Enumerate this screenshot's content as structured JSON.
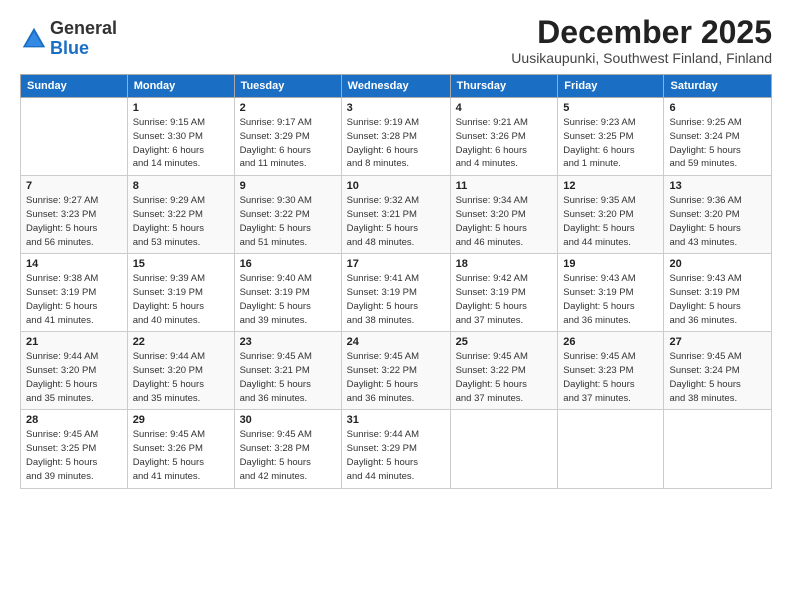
{
  "header": {
    "logo_general": "General",
    "logo_blue": "Blue",
    "main_title": "December 2025",
    "subtitle": "Uusikaupunki, Southwest Finland, Finland"
  },
  "days_of_week": [
    "Sunday",
    "Monday",
    "Tuesday",
    "Wednesday",
    "Thursday",
    "Friday",
    "Saturday"
  ],
  "weeks": [
    [
      {
        "day": "",
        "info": ""
      },
      {
        "day": "1",
        "info": "Sunrise: 9:15 AM\nSunset: 3:30 PM\nDaylight: 6 hours\nand 14 minutes."
      },
      {
        "day": "2",
        "info": "Sunrise: 9:17 AM\nSunset: 3:29 PM\nDaylight: 6 hours\nand 11 minutes."
      },
      {
        "day": "3",
        "info": "Sunrise: 9:19 AM\nSunset: 3:28 PM\nDaylight: 6 hours\nand 8 minutes."
      },
      {
        "day": "4",
        "info": "Sunrise: 9:21 AM\nSunset: 3:26 PM\nDaylight: 6 hours\nand 4 minutes."
      },
      {
        "day": "5",
        "info": "Sunrise: 9:23 AM\nSunset: 3:25 PM\nDaylight: 6 hours\nand 1 minute."
      },
      {
        "day": "6",
        "info": "Sunrise: 9:25 AM\nSunset: 3:24 PM\nDaylight: 5 hours\nand 59 minutes."
      }
    ],
    [
      {
        "day": "7",
        "info": "Sunrise: 9:27 AM\nSunset: 3:23 PM\nDaylight: 5 hours\nand 56 minutes."
      },
      {
        "day": "8",
        "info": "Sunrise: 9:29 AM\nSunset: 3:22 PM\nDaylight: 5 hours\nand 53 minutes."
      },
      {
        "day": "9",
        "info": "Sunrise: 9:30 AM\nSunset: 3:22 PM\nDaylight: 5 hours\nand 51 minutes."
      },
      {
        "day": "10",
        "info": "Sunrise: 9:32 AM\nSunset: 3:21 PM\nDaylight: 5 hours\nand 48 minutes."
      },
      {
        "day": "11",
        "info": "Sunrise: 9:34 AM\nSunset: 3:20 PM\nDaylight: 5 hours\nand 46 minutes."
      },
      {
        "day": "12",
        "info": "Sunrise: 9:35 AM\nSunset: 3:20 PM\nDaylight: 5 hours\nand 44 minutes."
      },
      {
        "day": "13",
        "info": "Sunrise: 9:36 AM\nSunset: 3:20 PM\nDaylight: 5 hours\nand 43 minutes."
      }
    ],
    [
      {
        "day": "14",
        "info": "Sunrise: 9:38 AM\nSunset: 3:19 PM\nDaylight: 5 hours\nand 41 minutes."
      },
      {
        "day": "15",
        "info": "Sunrise: 9:39 AM\nSunset: 3:19 PM\nDaylight: 5 hours\nand 40 minutes."
      },
      {
        "day": "16",
        "info": "Sunrise: 9:40 AM\nSunset: 3:19 PM\nDaylight: 5 hours\nand 39 minutes."
      },
      {
        "day": "17",
        "info": "Sunrise: 9:41 AM\nSunset: 3:19 PM\nDaylight: 5 hours\nand 38 minutes."
      },
      {
        "day": "18",
        "info": "Sunrise: 9:42 AM\nSunset: 3:19 PM\nDaylight: 5 hours\nand 37 minutes."
      },
      {
        "day": "19",
        "info": "Sunrise: 9:43 AM\nSunset: 3:19 PM\nDaylight: 5 hours\nand 36 minutes."
      },
      {
        "day": "20",
        "info": "Sunrise: 9:43 AM\nSunset: 3:19 PM\nDaylight: 5 hours\nand 36 minutes."
      }
    ],
    [
      {
        "day": "21",
        "info": "Sunrise: 9:44 AM\nSunset: 3:20 PM\nDaylight: 5 hours\nand 35 minutes."
      },
      {
        "day": "22",
        "info": "Sunrise: 9:44 AM\nSunset: 3:20 PM\nDaylight: 5 hours\nand 35 minutes."
      },
      {
        "day": "23",
        "info": "Sunrise: 9:45 AM\nSunset: 3:21 PM\nDaylight: 5 hours\nand 36 minutes."
      },
      {
        "day": "24",
        "info": "Sunrise: 9:45 AM\nSunset: 3:22 PM\nDaylight: 5 hours\nand 36 minutes."
      },
      {
        "day": "25",
        "info": "Sunrise: 9:45 AM\nSunset: 3:22 PM\nDaylight: 5 hours\nand 37 minutes."
      },
      {
        "day": "26",
        "info": "Sunrise: 9:45 AM\nSunset: 3:23 PM\nDaylight: 5 hours\nand 37 minutes."
      },
      {
        "day": "27",
        "info": "Sunrise: 9:45 AM\nSunset: 3:24 PM\nDaylight: 5 hours\nand 38 minutes."
      }
    ],
    [
      {
        "day": "28",
        "info": "Sunrise: 9:45 AM\nSunset: 3:25 PM\nDaylight: 5 hours\nand 39 minutes."
      },
      {
        "day": "29",
        "info": "Sunrise: 9:45 AM\nSunset: 3:26 PM\nDaylight: 5 hours\nand 41 minutes."
      },
      {
        "day": "30",
        "info": "Sunrise: 9:45 AM\nSunset: 3:28 PM\nDaylight: 5 hours\nand 42 minutes."
      },
      {
        "day": "31",
        "info": "Sunrise: 9:44 AM\nSunset: 3:29 PM\nDaylight: 5 hours\nand 44 minutes."
      },
      {
        "day": "",
        "info": ""
      },
      {
        "day": "",
        "info": ""
      },
      {
        "day": "",
        "info": ""
      }
    ]
  ]
}
